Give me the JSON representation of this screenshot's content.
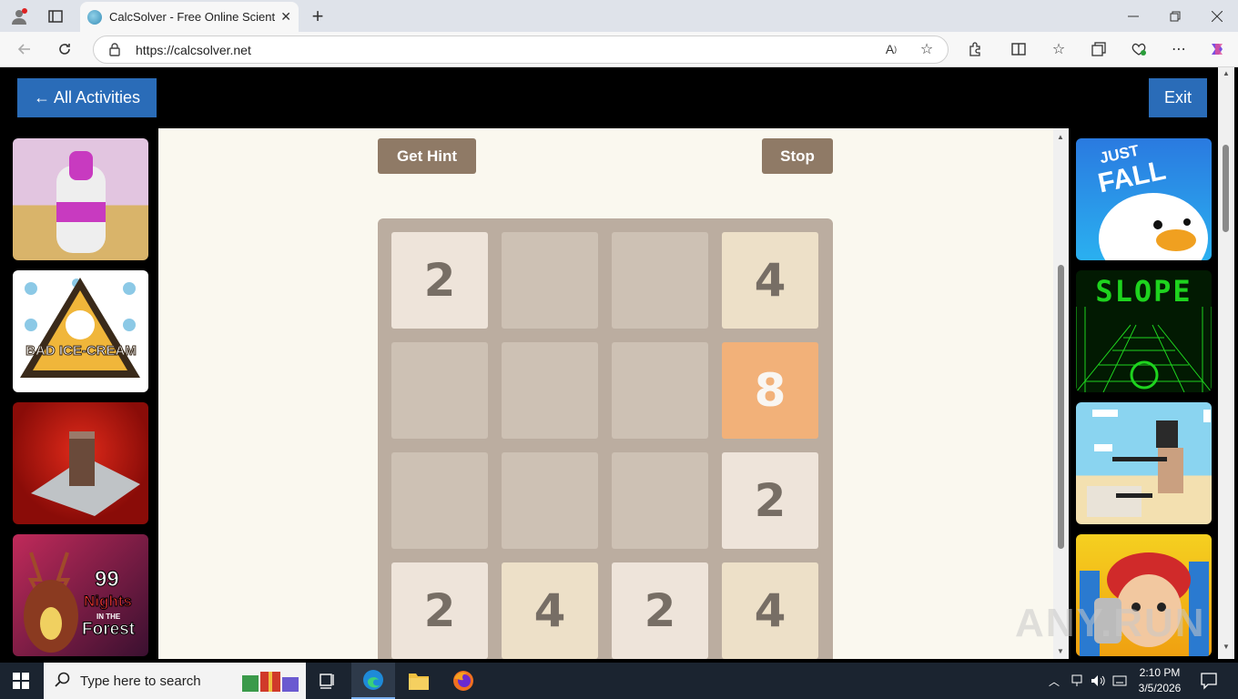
{
  "browser": {
    "tab_title": "CalcSolver - Free Online Scientific",
    "url": "https://calcsolver.net"
  },
  "topbar": {
    "back_label": "← All Activities",
    "exit_label": "Exit"
  },
  "game": {
    "hint_label": "Get Hint",
    "stop_label": "Stop",
    "board": [
      [
        "2",
        "",
        "",
        "4"
      ],
      [
        "",
        "",
        "",
        "8"
      ],
      [
        "",
        "",
        "",
        "2"
      ],
      [
        "2",
        "4",
        "2",
        "4"
      ]
    ]
  },
  "left_thumbs": {
    "t2": "BAD ICE-CREAM",
    "t4a": "99",
    "t4b": "Nights",
    "t4c": "IN THE",
    "t4d": "Forest"
  },
  "right_thumbs": {
    "t1a": "JUST",
    "t1b": "FALL",
    "t2": "SLOPE"
  },
  "taskbar": {
    "search_placeholder": "Type here to search",
    "time": "2:10 PM",
    "date": "3/5/2026"
  },
  "watermark": "ANY.RUN"
}
